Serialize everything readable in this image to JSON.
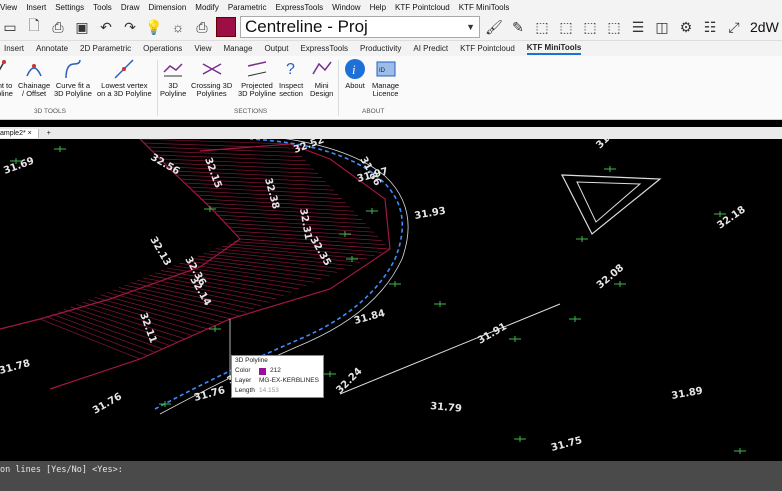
{
  "menu": {
    "items": [
      "View",
      "Insert",
      "Settings",
      "Tools",
      "Draw",
      "Dimension",
      "Modify",
      "Parametric",
      "ExpressTools",
      "Window",
      "Help",
      "KTF Pointcloud",
      "KTF MiniTools"
    ]
  },
  "toolbar": {
    "layer_color": "#9c0f46",
    "layer_name": "Centreline - Proj",
    "right_label": "2dW"
  },
  "ribbon_tabs": [
    "Insert",
    "Annotate",
    "2D Parametric",
    "Operations",
    "View",
    "Manage",
    "Output",
    "ExpressTools",
    "Productivity",
    "AI Predict",
    "KTF Pointcloud",
    "KTF MiniTools"
  ],
  "ribbon_active_tab": "KTF MiniTools",
  "ribbon": {
    "buttons": [
      {
        "name": "point-to-polyline",
        "l1": "nt to",
        "l2": "oline"
      },
      {
        "name": "chainage-offset",
        "l1": "Chainage",
        "l2": "/ Offset"
      },
      {
        "name": "curve-fit",
        "l1": "Curve fit a",
        "l2": "3D Polyline"
      },
      {
        "name": "lowest-vertex",
        "l1": "Lowest vertex",
        "l2": "on a 3D Polyline"
      },
      {
        "name": "section-3d-polyline",
        "l1": "3D",
        "l2": "Polyline"
      },
      {
        "name": "crossing-3d",
        "l1": "Crossing 3D",
        "l2": "Polylines"
      },
      {
        "name": "projected-3d",
        "l1": "Projected",
        "l2": "3D Polyline"
      },
      {
        "name": "inspect-section",
        "l1": "Inspect",
        "l2": "section"
      },
      {
        "name": "mini-design",
        "l1": "Mini",
        "l2": "Design"
      },
      {
        "name": "about",
        "l1": "About",
        "l2": ""
      },
      {
        "name": "manage-licence",
        "l1": "Manage",
        "l2": "Licence"
      }
    ],
    "panels": {
      "tools": "3D TOOLS",
      "sections": "SECTIONS",
      "about": "ABOUT"
    }
  },
  "doc_tab": {
    "name": "ample2*",
    "add": "+"
  },
  "canvas_labels": [
    "32.52",
    "31.97",
    "31.93",
    "32.15",
    "32.38",
    "32.31",
    "32.13",
    "32.36",
    "32.14",
    "32.11",
    "31.84",
    "31.76",
    "31.76",
    "31.79",
    "31.89",
    "31.75",
    "31.91",
    "32.18",
    "32.08",
    "31.50",
    "31.78",
    "32.35",
    "32.56",
    "32.24",
    "31.69",
    "31.86",
    "32.19"
  ],
  "tooltip": {
    "title": "3D Polyline",
    "color_label": "Color",
    "color_value": "212",
    "layer_label": "Layer",
    "layer_value": "MG-EX-KERBLINES",
    "length_label": "Length",
    "length_value": "14.153"
  },
  "command_line": "on lines [Yes/No] <Yes>:"
}
